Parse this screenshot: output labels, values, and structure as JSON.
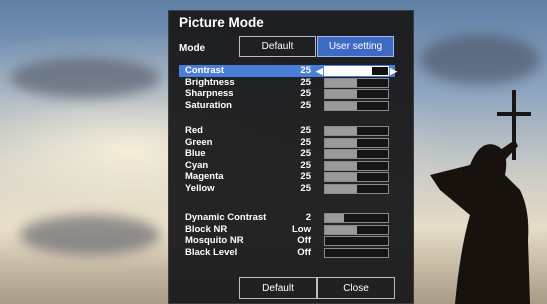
{
  "title": "Picture Mode",
  "mode": {
    "label": "Mode",
    "options": [
      "Default",
      "User setting"
    ],
    "selected": 1
  },
  "groups": [
    [
      {
        "label": "Contrast",
        "value": "25",
        "level": 0.75,
        "selected": true
      },
      {
        "label": "Brightness",
        "value": "25",
        "level": 0.5
      },
      {
        "label": "Sharpness",
        "value": "25",
        "level": 0.5
      },
      {
        "label": "Saturation",
        "value": "25",
        "level": 0.5
      }
    ],
    [
      {
        "label": "Red",
        "value": "25",
        "level": 0.5
      },
      {
        "label": "Green",
        "value": "25",
        "level": 0.5
      },
      {
        "label": "Blue",
        "value": "25",
        "level": 0.5
      },
      {
        "label": "Cyan",
        "value": "25",
        "level": 0.5
      },
      {
        "label": "Magenta",
        "value": "25",
        "level": 0.5
      },
      {
        "label": "Yellow",
        "value": "25",
        "level": 0.5
      }
    ],
    [
      {
        "label": "Dynamic Contrast",
        "value": "2",
        "level": 0.3
      },
      {
        "label": "Block NR",
        "value": "Low",
        "level": 0.5
      },
      {
        "label": "Mosquito NR",
        "value": "Off",
        "level": 0
      },
      {
        "label": "Black Level",
        "value": "Off",
        "level": 0
      }
    ]
  ],
  "footer": {
    "default_label": "Default",
    "close_label": "Close"
  },
  "colors": {
    "accent": "#4a7fd7",
    "active_button": "#3e6ac6",
    "panel": "#18181a"
  }
}
